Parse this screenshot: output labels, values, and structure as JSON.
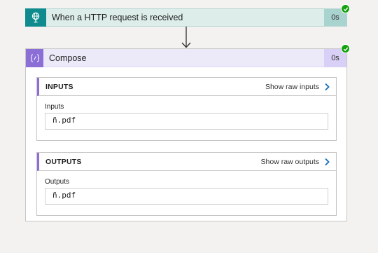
{
  "trigger": {
    "title": "When a HTTP request is received",
    "duration": "0s",
    "icon": "globe-request-icon",
    "status_icon": "success-check-icon"
  },
  "compose": {
    "title": "Compose",
    "duration": "0s",
    "icon": "curly-braces-icon",
    "status_icon": "success-check-icon",
    "inputs": {
      "section_title": "INPUTS",
      "raw_link": "Show raw inputs",
      "field_label": "Inputs",
      "field_value": "ñ.pdf"
    },
    "outputs": {
      "section_title": "OUTPUTS",
      "raw_link": "Show raw outputs",
      "field_label": "Outputs",
      "field_value": "ñ.pdf"
    }
  },
  "colors": {
    "trigger_accent": "#0f8b8d",
    "compose_accent": "#8b6fd6",
    "success": "#13a10e",
    "background": "#f3f2f1"
  }
}
